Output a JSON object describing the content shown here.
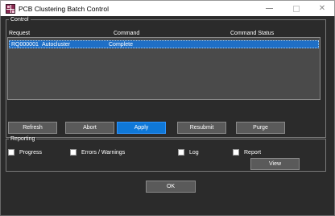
{
  "window": {
    "title": "PCB Clustering Batch Control",
    "minimize_label": "",
    "maximize_label": "",
    "close_label": "✕"
  },
  "control": {
    "legend": "Control",
    "columns": [
      "Request",
      "Command",
      "Command Status"
    ],
    "rows": [
      {
        "request": "RQ000001",
        "type": "Autocluster",
        "command": "Complete",
        "status": ""
      }
    ]
  },
  "buttons": {
    "refresh": "Refresh",
    "abort": "Abort",
    "apply": "Apply",
    "resubmit": "Resubmit",
    "purge": "Purge",
    "view": "View",
    "ok": "OK"
  },
  "reporting": {
    "legend": "Reporting",
    "options": [
      {
        "label": "Progress",
        "checked": false
      },
      {
        "label": "Errors / Warnings",
        "checked": false
      },
      {
        "label": "Log",
        "checked": false
      },
      {
        "label": "Report",
        "checked": false
      }
    ]
  },
  "colors": {
    "background": "#2b2b2b",
    "selection": "#1f6fc6",
    "primary_button": "#0f78d8",
    "icon_accent": "#8a2a52"
  },
  "icons": {
    "app": "pcb-app-icon",
    "minimize": "minimize-icon",
    "maximize": "maximize-icon",
    "close": "close-icon"
  }
}
